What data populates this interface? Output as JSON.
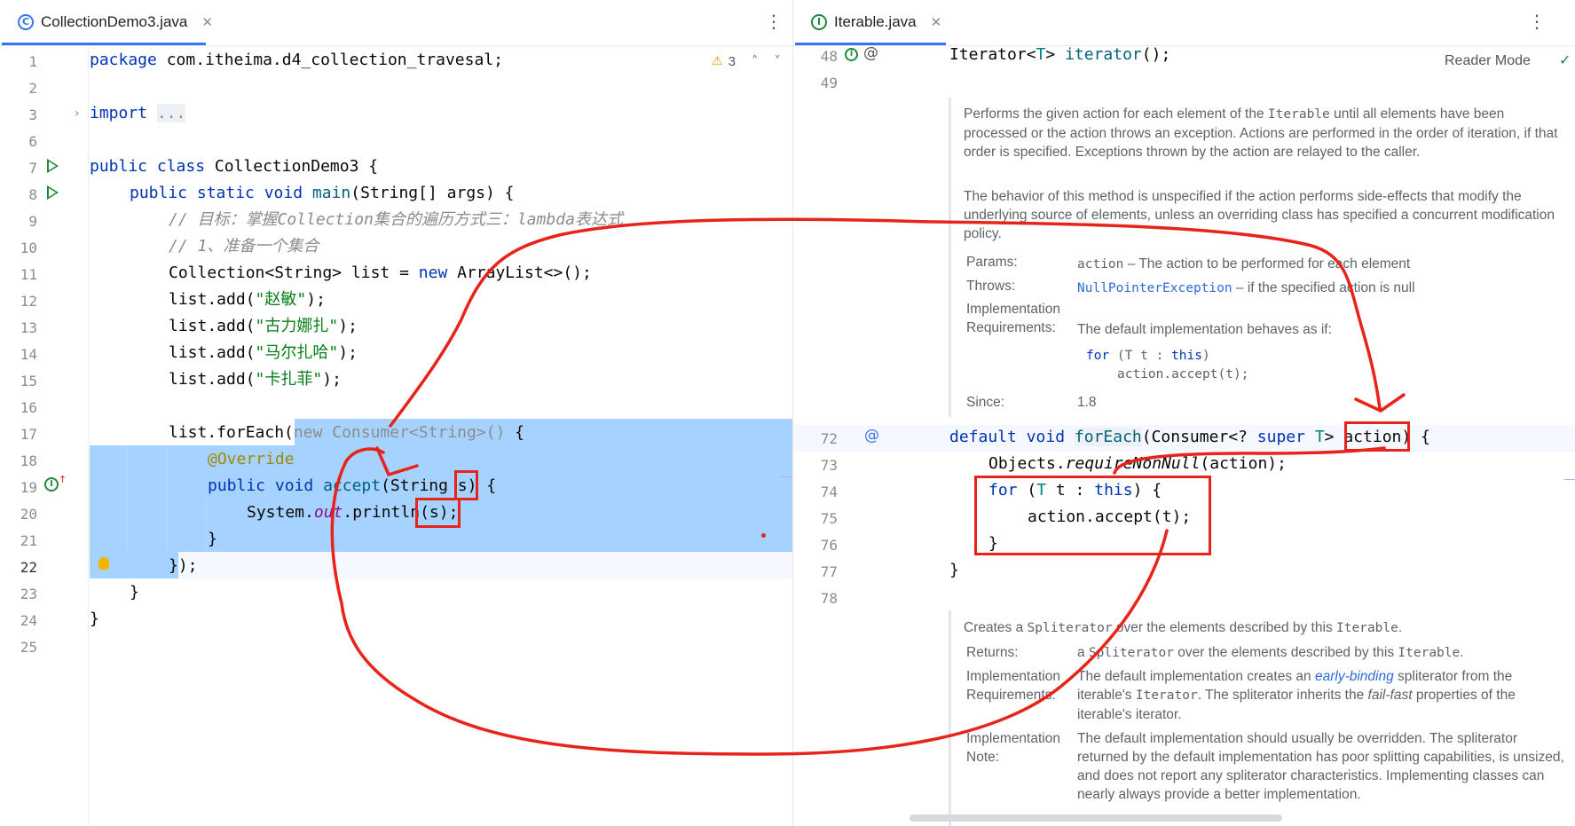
{
  "left_tab": {
    "title": "CollectionDemo3.java",
    "icon": "C"
  },
  "right_tab": {
    "title": "Iterable.java",
    "icon": "I"
  },
  "warnings": {
    "count": "3"
  },
  "reader_mode": "Reader Mode",
  "left_code": {
    "line_numbers": [
      "1",
      "2",
      "3",
      "6",
      "7",
      "8",
      "9",
      "10",
      "11",
      "12",
      "13",
      "14",
      "15",
      "16",
      "17",
      "18",
      "19",
      "20",
      "21",
      "22",
      "23",
      "24",
      "25"
    ],
    "l1_kw": "package",
    "l1_rest": " com.itheima.d4_collection_travesal;",
    "l3_kw": "import",
    "l3_fold": "...",
    "l7_kw": "public class",
    "l7_rest": " CollectionDemo3 {",
    "l8_kw": "public static void",
    "l8_fn": "main",
    "l8_rest": "(String[] args) {",
    "l9": "// 目标：掌握Collection集合的遍历方式三：lambda表达式",
    "l10": "// 1、准备一个集合",
    "l11_a": "Collection<String> list = ",
    "l11_kw": "new",
    "l11_b": " ArrayList<>();",
    "add_prefix": "list.add(",
    "add_suffix": ");",
    "s1": "\"赵敏\"",
    "s2": "\"古力娜扎\"",
    "s3": "\"马尔扎哈\"",
    "s4": "\"卡扎菲\"",
    "l17_a": "list.forEach(",
    "l17_b": "new Consumer<String>()",
    "l17_c": " {",
    "l18": "@Override",
    "l19_kw": "public void",
    "l19_fn": "accept",
    "l19_rest": "(String s) {",
    "l20_a": "System.",
    "l20_fld": "out",
    "l20_b": ".println(s);",
    "l21": "}",
    "l22": "});",
    "l23": "}",
    "l24": "}"
  },
  "right_code": {
    "line_numbers": [
      "48",
      "49",
      "72",
      "73",
      "74",
      "75",
      "76",
      "77",
      "78"
    ],
    "l48_a": "Iterator<",
    "l48_t": "T",
    "l48_b": "> ",
    "l48_fn": "iterator",
    "l48_c": "();",
    "l72_kw": "default void",
    "l72_fn": "forEach",
    "l72_a": "(Consumer<? ",
    "l72_kw2": "super",
    "l72_t": " T",
    "l72_b": "> action) {",
    "l73_a": "Objects.",
    "l73_fn": "requireNonNull",
    "l73_b": "(action);",
    "l74_kw": "for",
    "l74_a": " (",
    "l74_t": "T",
    "l74_b": " t : ",
    "l74_kw2": "this",
    "l74_c": ") {",
    "l75": "action.accept(t);",
    "l76": "}",
    "l77": "}"
  },
  "doc1": {
    "p1_a": "Performs the given action for each element of the ",
    "p1_code": "Iterable",
    "p1_b": " until all elements have been processed or the action throws an exception. Actions are performed in the order of iteration, if that order is specified. Exceptions thrown by the action are relayed to the caller.",
    "p2": "The behavior of this method is unspecified if the action performs side-effects that modify the underlying source of elements, unless an overriding class has specified a concurrent modification policy.",
    "params_label": "Params:",
    "params_code": "action",
    "params_text": " – The action to be performed for each element",
    "throws_label": "Throws:",
    "throws_code": "NullPointerException",
    "throws_text": " – if the specified action is null",
    "impl_label_1": "Implementation",
    "impl_label_2": "Requirements:",
    "impl_text": "The default implementation behaves as if:",
    "impl_code_1_kw": "for",
    "impl_code_1_a": " (T t : ",
    "impl_code_1_kw2": "this",
    "impl_code_1_b": ")",
    "impl_code_2": "action.accept(t);",
    "since_label": "Since:",
    "since_value": "1.8"
  },
  "doc2": {
    "p1_a": "Creates a ",
    "p1_code": "Spliterator",
    "p1_b": " over the elements described by this ",
    "p1_code2": "Iterable",
    "p1_c": ".",
    "returns_label": "Returns:",
    "returns_a": "a ",
    "returns_code": "Spliterator",
    "returns_b": " over the elements described by this ",
    "returns_code2": "Iterable",
    "returns_c": ".",
    "impl_label_1": "Implementation",
    "impl_label_2": "Requirements:",
    "impl_a": "The default implementation creates an ",
    "impl_link": "early-binding",
    "impl_b": " spliterator from the iterable's ",
    "impl_code": "Iterator",
    "impl_c": ". The spliterator inherits the ",
    "impl_ital": "fail-fast",
    "impl_d": " properties of the iterable's iterator.",
    "note_label_1": "Implementation",
    "note_label_2": "Note:",
    "note_text": "The default implementation should usually be overridden. The spliterator returned by the default implementation has poor splitting capabilities, is unsized, and does not report any spliterator characteristics. Implementing classes can nearly always provide a better implementation."
  },
  "colors": {
    "annotation_red": "#e8231a",
    "selection": "#a6d2ff",
    "keyword": "#0033b3",
    "string": "#067d17"
  }
}
